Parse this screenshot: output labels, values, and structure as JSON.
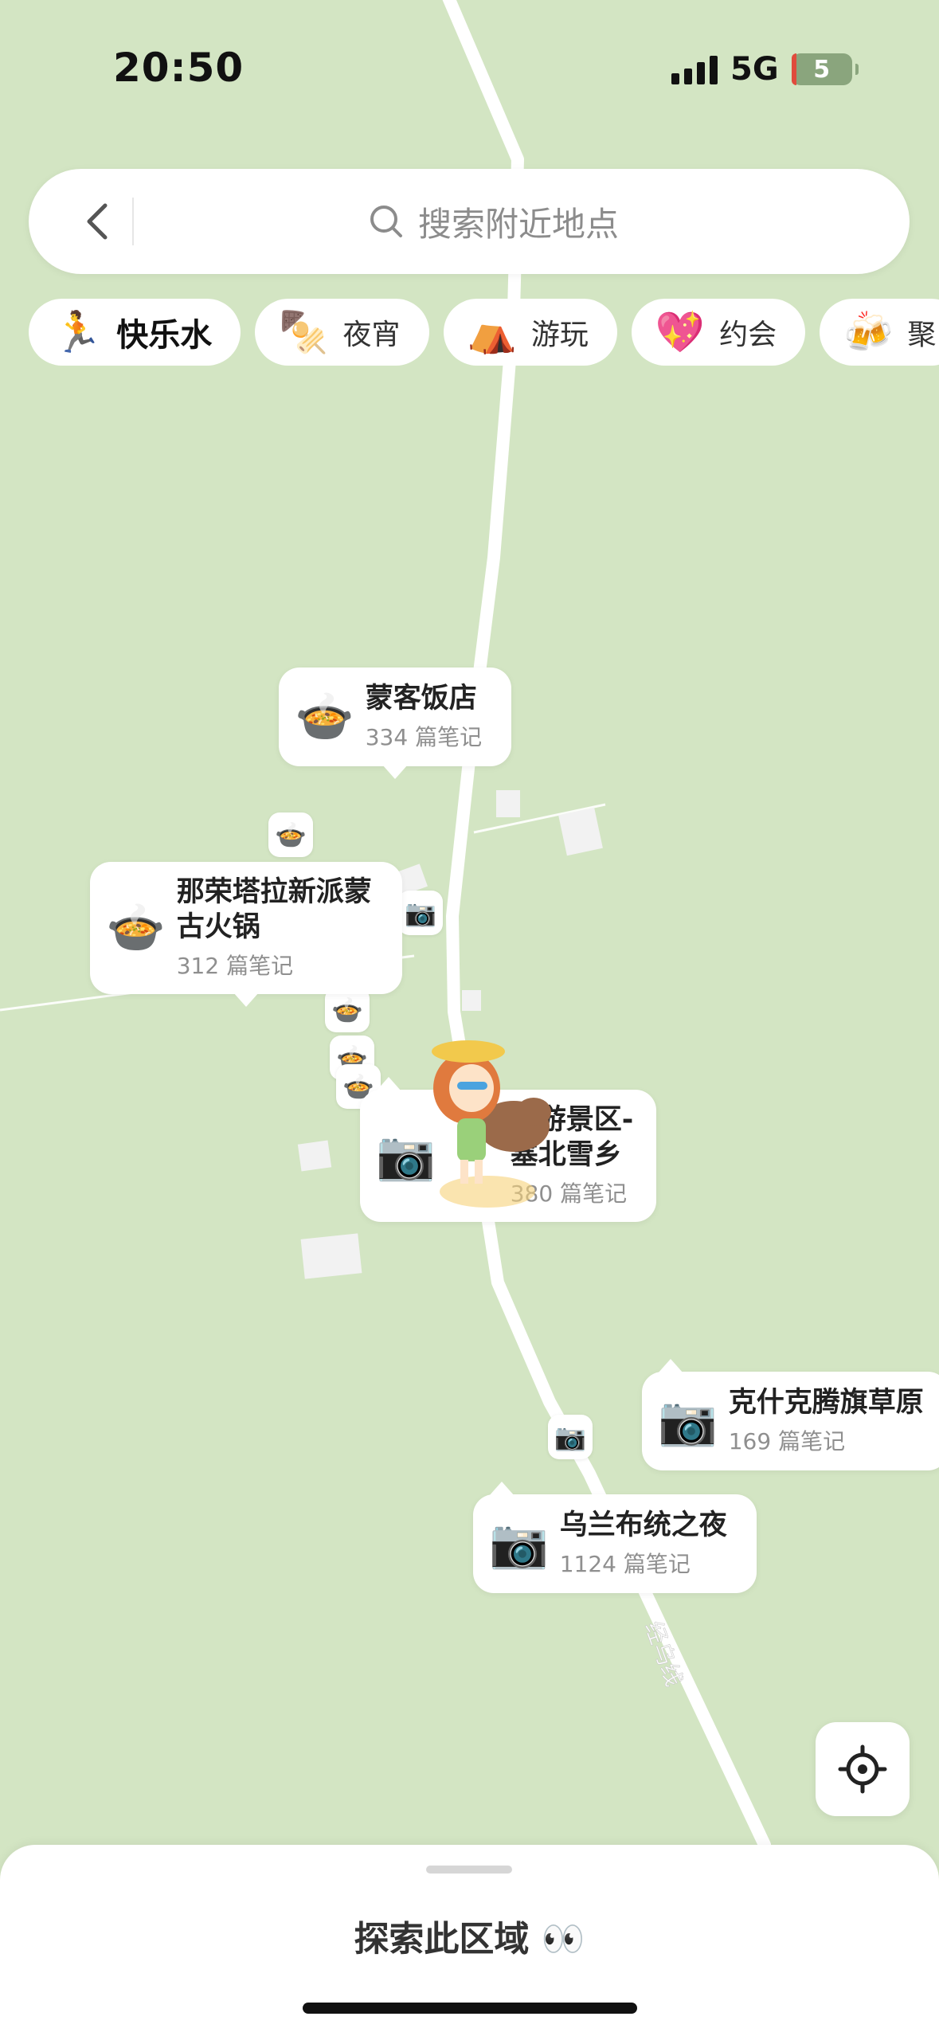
{
  "status": {
    "time": "20:50",
    "network": "5G",
    "battery": "5"
  },
  "search": {
    "placeholder": "搜索附近地点"
  },
  "chips": [
    {
      "label": "快乐水",
      "emoji": "🏃",
      "active": true
    },
    {
      "label": "夜宵",
      "emoji": "🍢"
    },
    {
      "label": "游玩",
      "emoji": "⛺"
    },
    {
      "label": "约会",
      "emoji": "💖"
    },
    {
      "label": "聚",
      "emoji": "🍻"
    }
  ],
  "pins": {
    "mengke": {
      "name": "蒙客饭店",
      "count": "334 篇笔记",
      "icon": "🍲"
    },
    "narong": {
      "name": "那荣塔拉新派蒙古火锅",
      "count": "312 篇笔记",
      "icon": "🍲"
    },
    "xuexiang": {
      "name": "旅游景区-塞北雪乡",
      "count": "380 篇笔记",
      "icon": "📷"
    },
    "keshiketeng": {
      "name": "克什克腾旗草原",
      "count": "169 篇笔记",
      "icon": "📷"
    },
    "wulanbutong": {
      "name": "乌兰布统之夜",
      "count": "1124 篇笔记",
      "icon": "📷"
    }
  },
  "road_label": "经乌线",
  "bottom_sheet": {
    "explore": "探索此区域 👀"
  }
}
